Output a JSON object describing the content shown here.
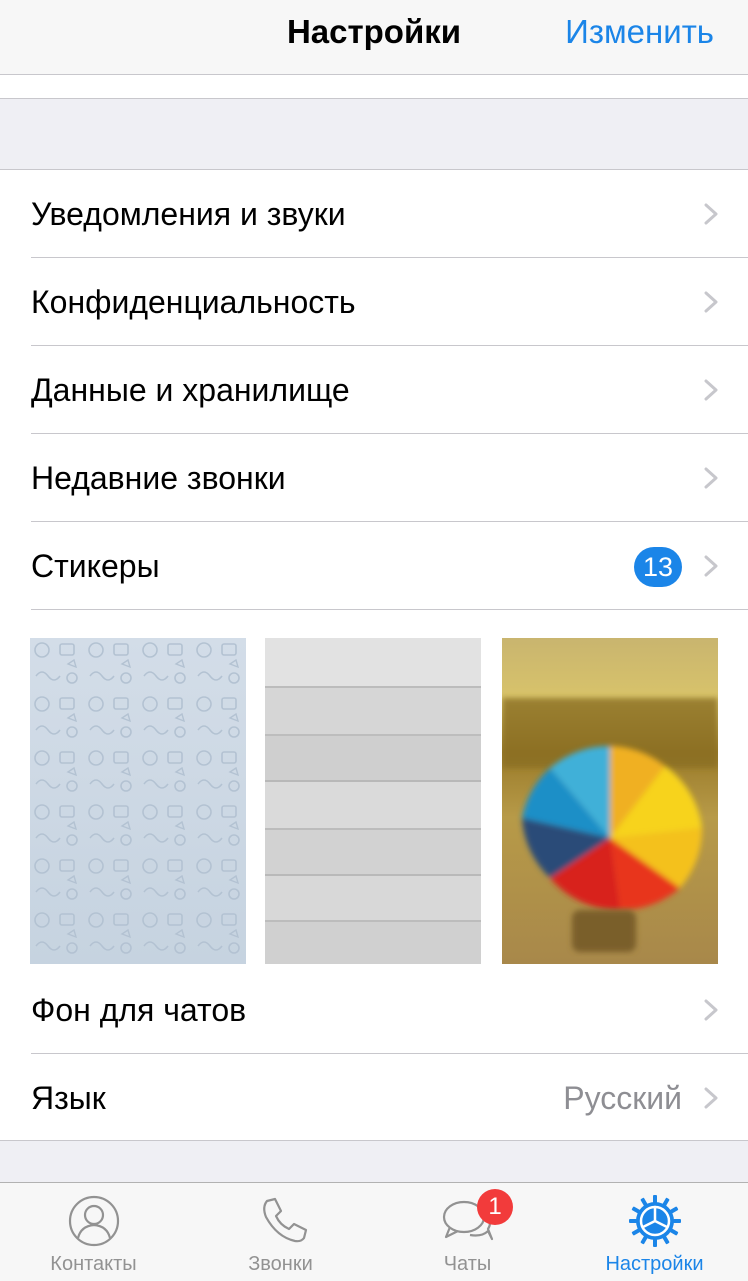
{
  "navbar": {
    "title": "Настройки",
    "edit_label": "Изменить"
  },
  "settings": {
    "notifications_label": "Уведомления и звуки",
    "privacy_label": "Конфиденциальность",
    "data_label": "Данные и хранилище",
    "recent_calls_label": "Недавние звонки",
    "stickers_label": "Стикеры",
    "stickers_badge": "13",
    "chat_background_label": "Фон для чатов",
    "language_label": "Язык",
    "language_value": "Русский"
  },
  "wallpapers": [
    {
      "name": "pattern",
      "icon": "doodle-pattern"
    },
    {
      "name": "wood",
      "icon": "grey-wood-planks"
    },
    {
      "name": "umbrella",
      "icon": "rainbow-umbrella-photo"
    }
  ],
  "tabbar": {
    "contacts_label": "Контакты",
    "calls_label": "Звонки",
    "chats_label": "Чаты",
    "chats_badge": "1",
    "settings_label": "Настройки"
  },
  "colors": {
    "accent": "#1b85e8",
    "badge_red": "#f23b3b",
    "background": "#efeff4",
    "separator": "#c8c7cc",
    "secondary_text": "#8e8e93",
    "tab_inactive": "#929292"
  },
  "icons": {
    "chevron": "chevron-right-icon",
    "contacts": "person-icon",
    "calls": "phone-icon",
    "chats": "speech-bubbles-icon",
    "settings": "gear-icon"
  }
}
